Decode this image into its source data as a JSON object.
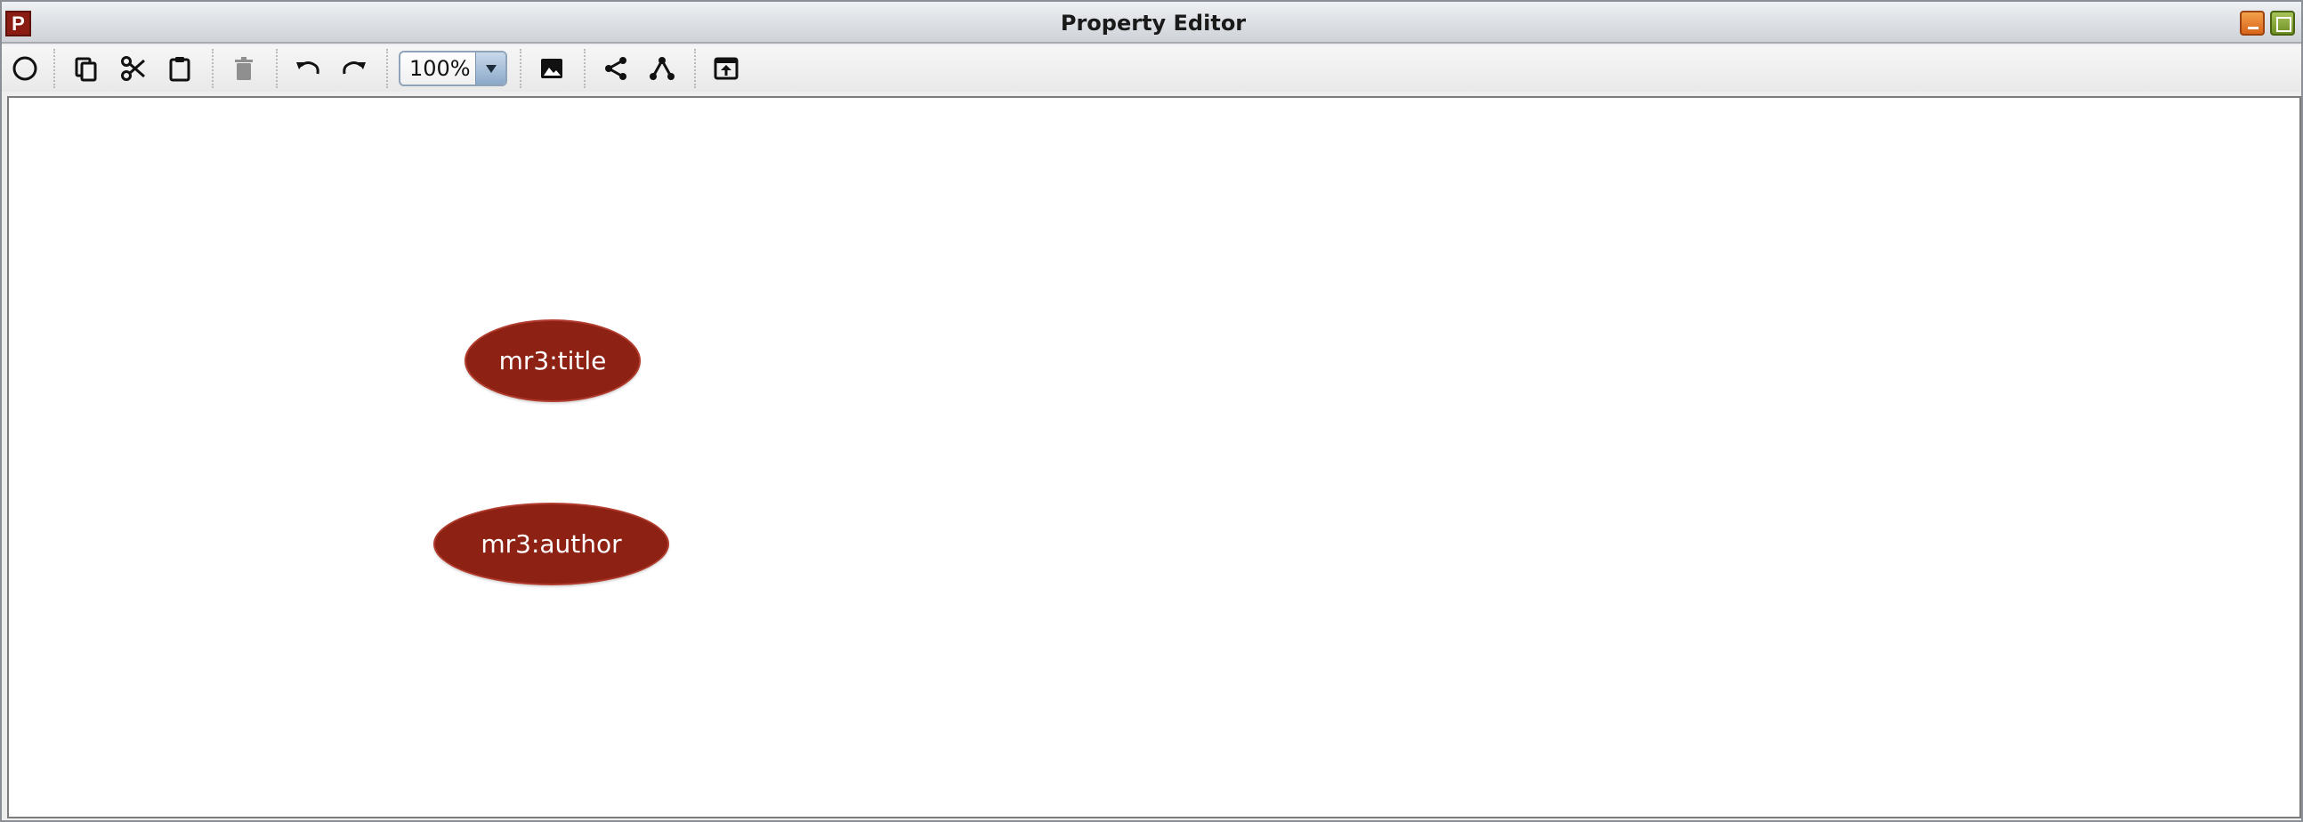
{
  "window": {
    "title": "Property Editor",
    "app_icon_letter": "P",
    "controls": [
      "minimize",
      "maximize"
    ],
    "colors": {
      "minimize": "#e67e22",
      "maximize": "#7a9a2e",
      "app_icon": "#8a1c14"
    }
  },
  "toolbar": {
    "buttons": [
      {
        "name": "insert-property",
        "icon": "circle-outline-icon"
      },
      {
        "name": "copy",
        "icon": "copy-icon"
      },
      {
        "name": "cut",
        "icon": "scissors-icon"
      },
      {
        "name": "paste",
        "icon": "clipboard-icon"
      },
      {
        "name": "delete",
        "icon": "trash-icon",
        "disabled": true
      },
      {
        "name": "undo",
        "icon": "undo-icon"
      },
      {
        "name": "redo",
        "icon": "redo-icon"
      },
      {
        "name": "export-image",
        "icon": "image-icon"
      },
      {
        "name": "graph-layout-share",
        "icon": "share-icon"
      },
      {
        "name": "graph-layout-tree",
        "icon": "tree-layout-icon"
      },
      {
        "name": "open-in-window",
        "icon": "open-window-icon"
      }
    ],
    "zoom": {
      "value": "100%"
    }
  },
  "canvas": {
    "node_color": "#8c2114",
    "nodes": [
      {
        "id": "title",
        "label": "mr3:title"
      },
      {
        "id": "author",
        "label": "mr3:author"
      }
    ]
  }
}
